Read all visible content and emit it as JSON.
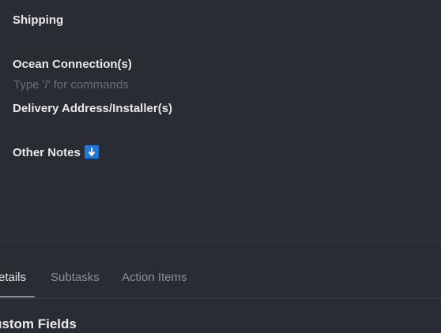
{
  "document": {
    "headings": {
      "shipping": "Shipping",
      "ocean_connections": "Ocean Connection(s)",
      "delivery_address": "Delivery Address/Installer(s)",
      "other_notes": "Other Notes"
    },
    "command_placeholder": "Type '/' for commands",
    "other_notes_icon": "down-arrow-emoji-icon",
    "icon_color": "#1f78d1"
  },
  "tabs": {
    "items": [
      {
        "label": "etails",
        "active": true
      },
      {
        "label": "Subtasks",
        "active": false
      },
      {
        "label": "Action Items",
        "active": false
      }
    ]
  },
  "section": {
    "title": "ustom Fields"
  }
}
